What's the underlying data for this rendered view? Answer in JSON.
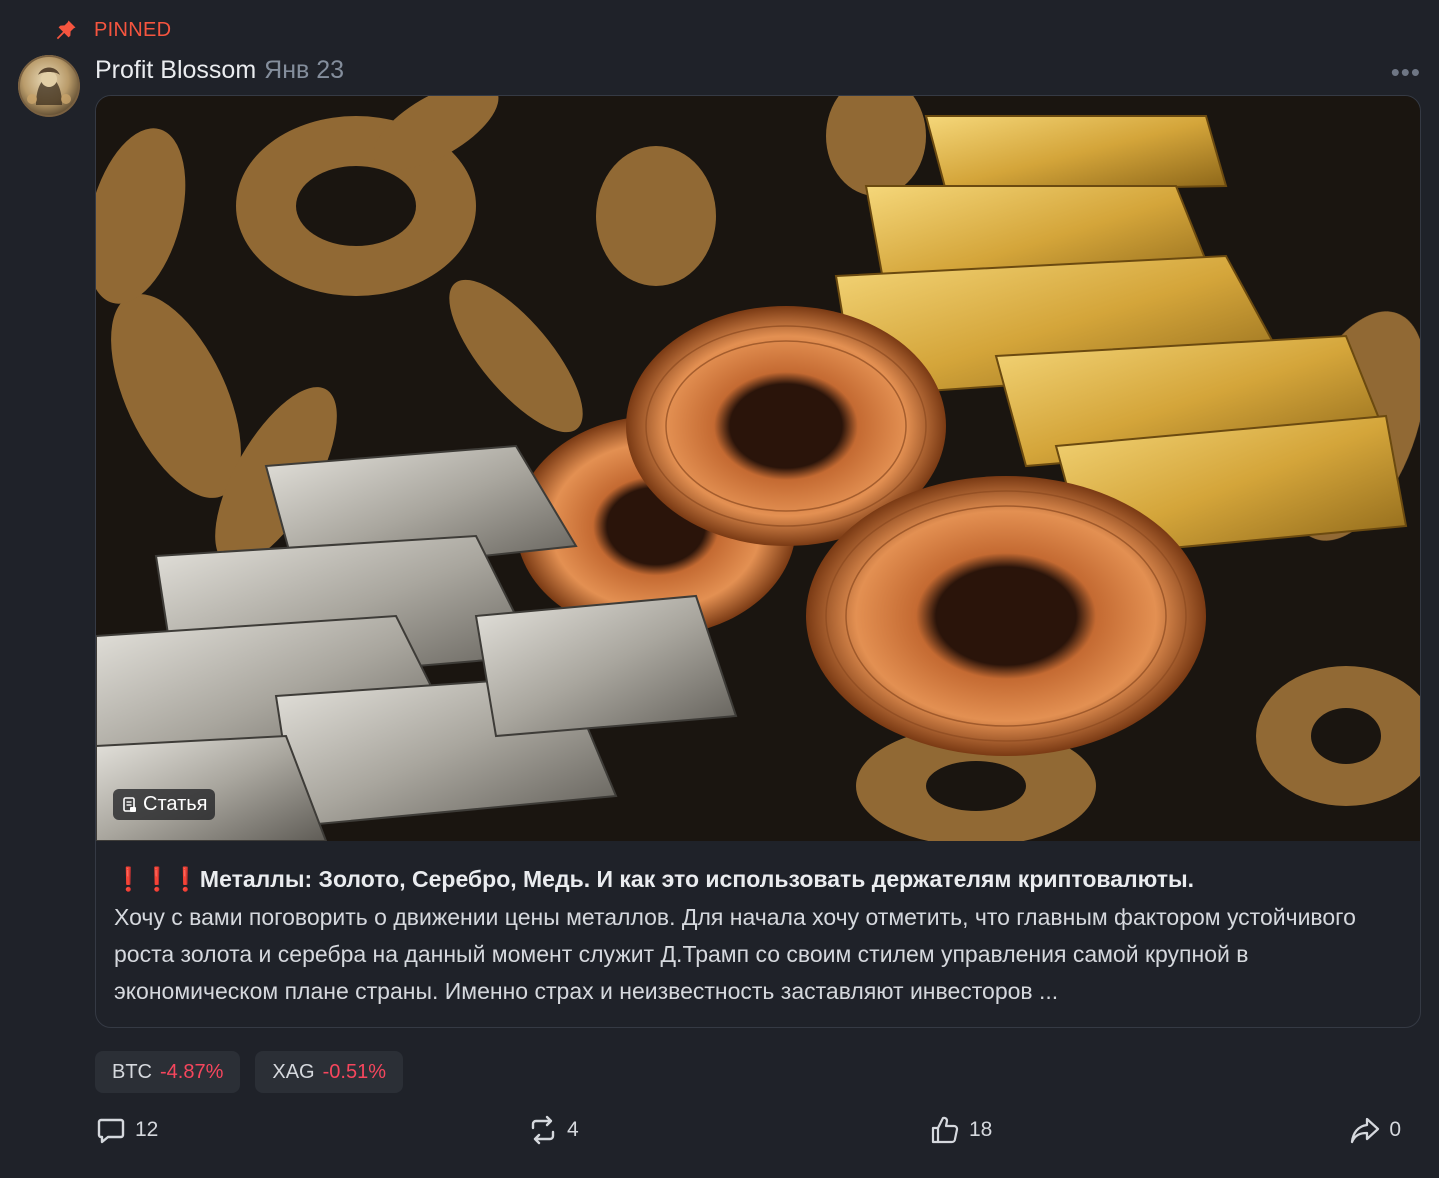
{
  "pinned_label": "PINNED",
  "post": {
    "author": "Profit Blossom",
    "date": "Янв 23",
    "more_label": "•••",
    "image_badge": "Статья",
    "title_prefix": "❗❗❗",
    "title": "Металлы: Золото, Серебро, Медь. И как это использовать держателям криптовалюты.",
    "text": "Хочу с вами поговорить о движении цены металлов. Для начала хочу отметить, что главным фактором устойчивого роста золота и серебра на данный момент служит Д.Трамп со своим стилем управления самой крупной в экономическом плане страны. Именно страх и неизвестность заставляют инвесторов ..."
  },
  "tickers": [
    {
      "symbol": "BTC",
      "change": "-4.87%"
    },
    {
      "symbol": "XAG",
      "change": "-0.51%"
    }
  ],
  "actions": {
    "comments": "12",
    "reposts": "4",
    "likes": "18",
    "shares": "0"
  },
  "colors": {
    "background": "#1f2229",
    "accent_pinned": "#f6553f",
    "negative": "#f6465d"
  }
}
